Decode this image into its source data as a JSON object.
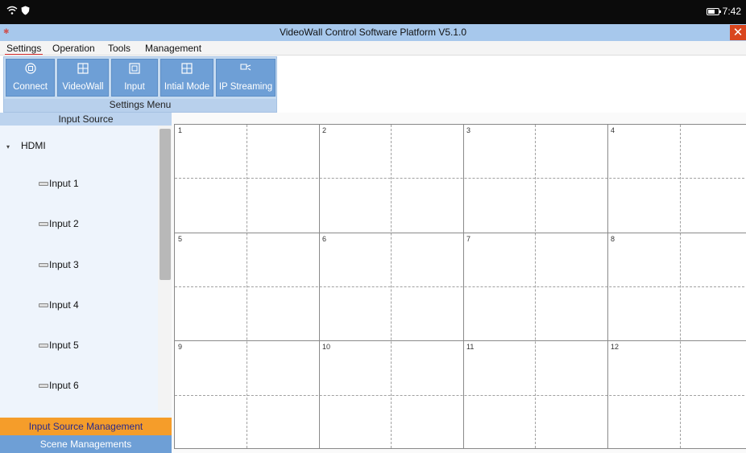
{
  "status_bar": {
    "time": "7:42",
    "icons": [
      "wifi-icon",
      "shield-icon",
      "battery-icon"
    ],
    "battery_level": 0.8
  },
  "window": {
    "title": "VideoWall Control Software Platform V5.1.0",
    "close_label": "✕"
  },
  "menu": {
    "items": [
      {
        "label": "Settings",
        "active": true
      },
      {
        "label": "Operation",
        "active": false
      },
      {
        "label": "Tools",
        "active": false
      },
      {
        "label": "Management",
        "active": false
      }
    ]
  },
  "ribbon": {
    "group_label": "Settings Menu",
    "buttons": [
      {
        "label": "Connect",
        "icon": "connect-icon"
      },
      {
        "label": "VideoWall",
        "icon": "videowall-icon"
      },
      {
        "label": "Input",
        "icon": "input-icon"
      },
      {
        "label": "Intial Mode",
        "icon": "grid-icon"
      },
      {
        "label": "IP Streaming",
        "icon": "streaming-icon"
      }
    ]
  },
  "input_source": {
    "header": "Input Source",
    "group": "HDMI",
    "items": [
      "Input 1",
      "Input 2",
      "Input 3",
      "Input 4",
      "Input 5",
      "Input 6"
    ]
  },
  "nav": {
    "input_source_management": "Input Source Management",
    "scene_managements": "Scene Managements"
  },
  "wall": {
    "screens": [
      "1",
      "2",
      "3",
      "4",
      "5",
      "6",
      "7",
      "8",
      "9",
      "10",
      "11",
      "12"
    ]
  },
  "colors": {
    "title_bar": "#a7c8ec",
    "ribbon_button": "#6e9fd6",
    "close_button": "#d9461e",
    "active_nav": "#f59d2a"
  }
}
